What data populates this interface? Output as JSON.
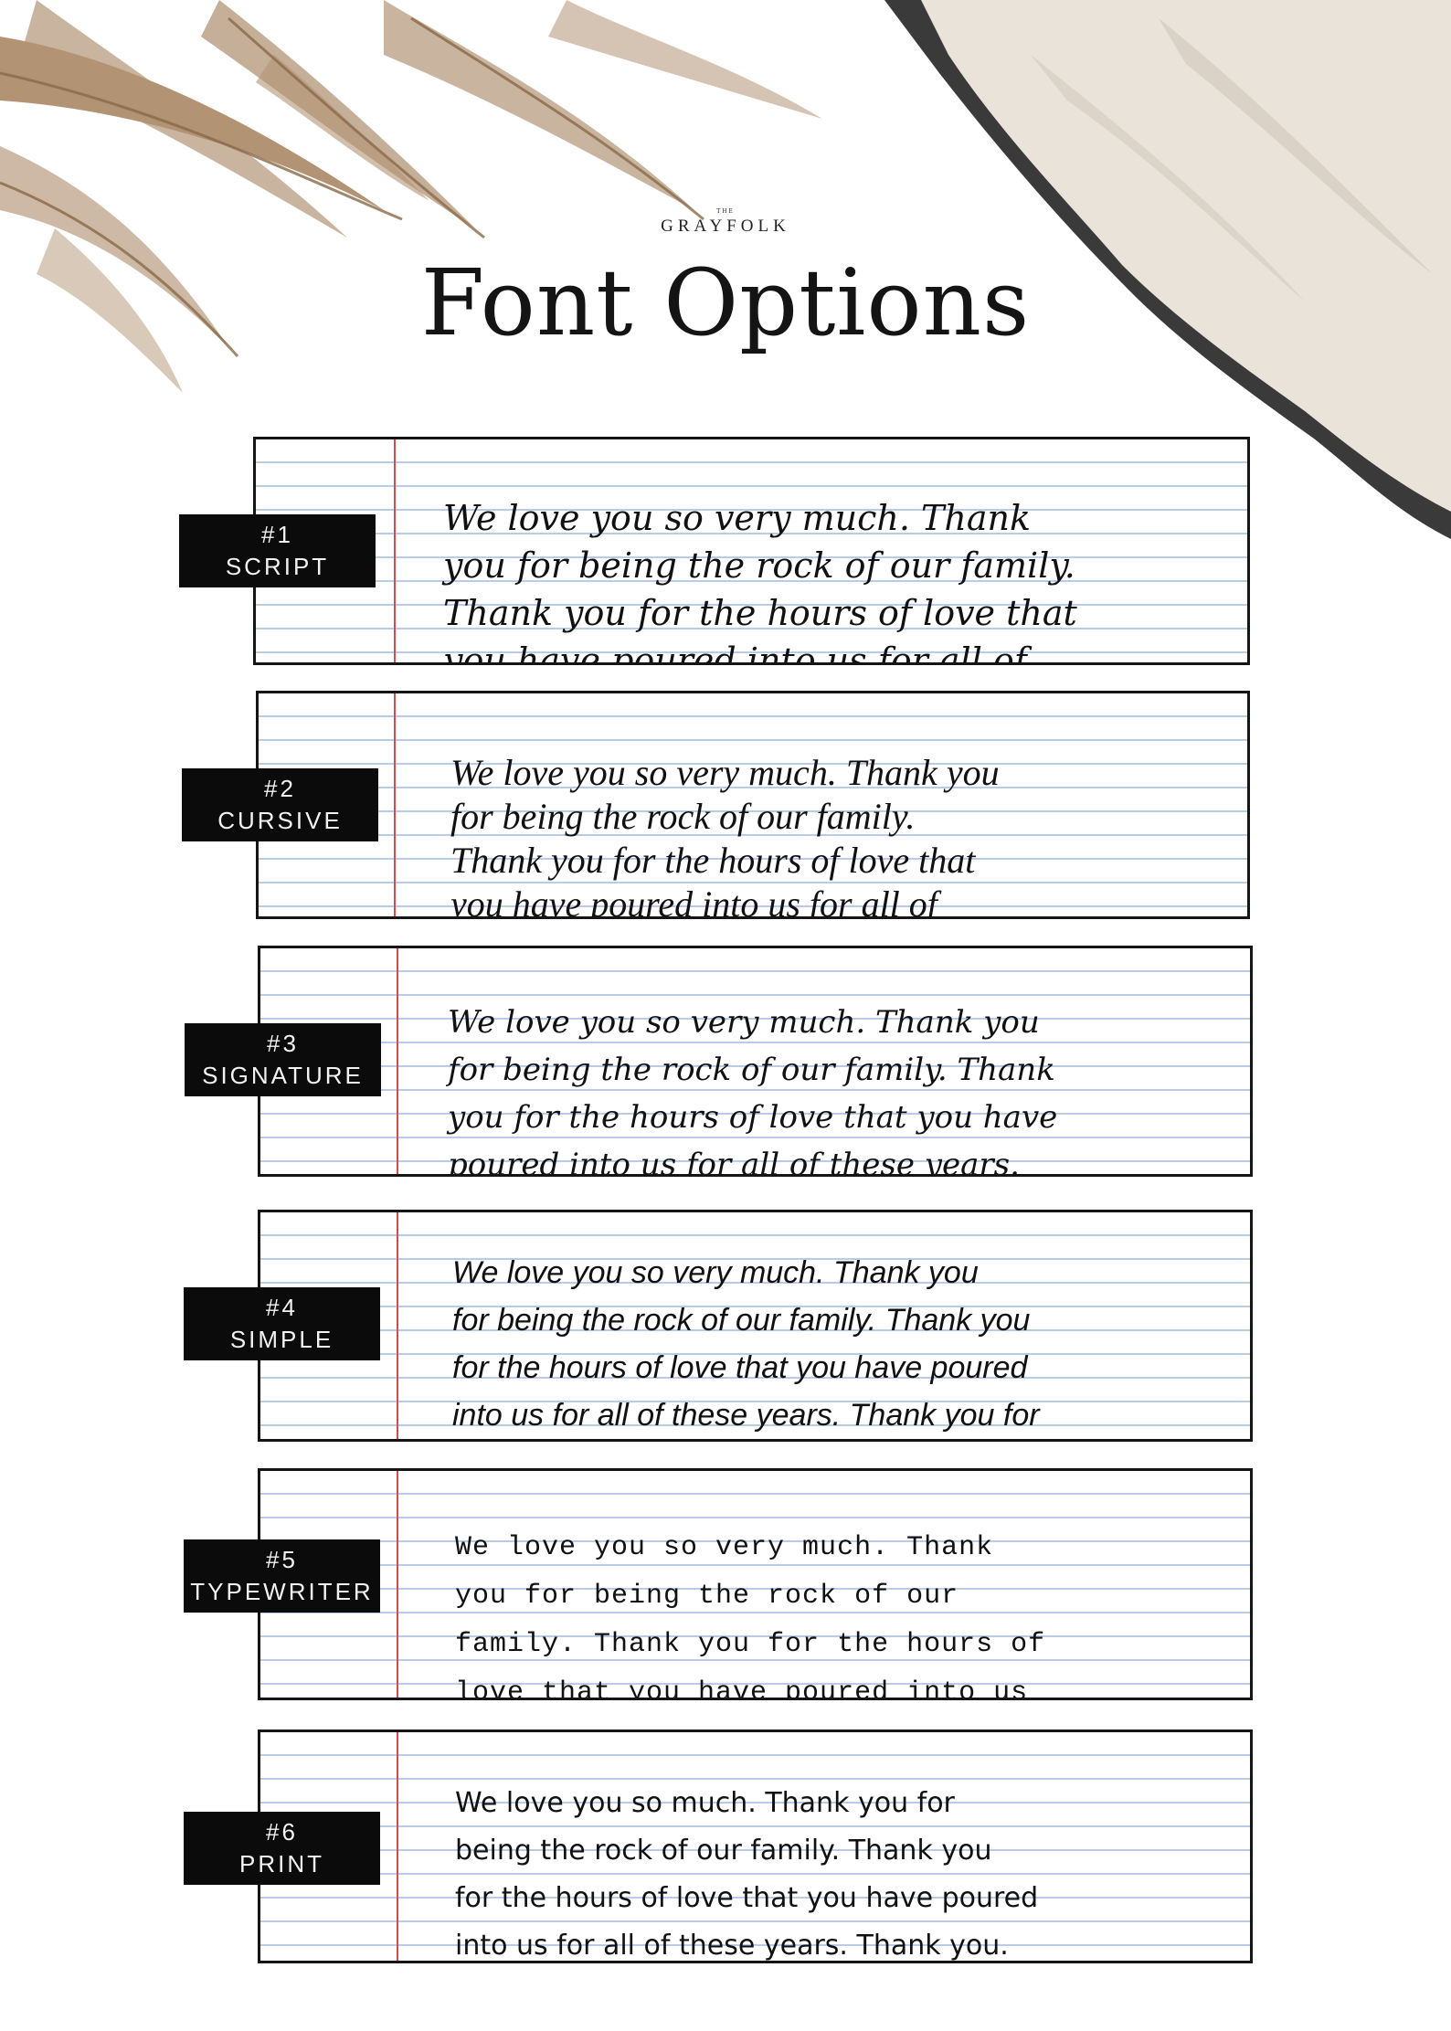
{
  "brand": {
    "small": "THE",
    "name": "GRAYFOLK"
  },
  "title": "Font Options",
  "options": [
    {
      "number": "#1",
      "name": "SCRIPT",
      "sample": "We love you so very much. Thank\nyou for being the rock of our family.\nThank you for the hours of love that\nyou have poured into us for all of"
    },
    {
      "number": "#2",
      "name": "CURSIVE",
      "sample": "We love you so very much. Thank you\nfor being the rock of our family.\nThank you for the hours of love that\nyou have poured into us for all of"
    },
    {
      "number": "#3",
      "name": "SIGNATURE",
      "sample": "We love you so very much. Thank you\nfor being the rock of our family. Thank\nyou for the hours of love that you have\npoured into us for all of these years."
    },
    {
      "number": "#4",
      "name": "SIMPLE",
      "sample": "We love you so very much. Thank you\nfor being the rock of our family. Thank you\nfor the hours of love that you have poured\ninto us for all of these years. Thank you for"
    },
    {
      "number": "#5",
      "name": "TYPEWRITER",
      "sample": "We love you so very much. Thank\nyou for being the rock of our\nfamily. Thank you for the hours of\nlove that you have poured into us"
    },
    {
      "number": "#6",
      "name": "PRINT",
      "sample": "We love you so much. Thank you for\nbeing the rock of our family. Thank you\nfor the hours of love that you have poured\ninto us for all of these years. Thank you."
    }
  ]
}
